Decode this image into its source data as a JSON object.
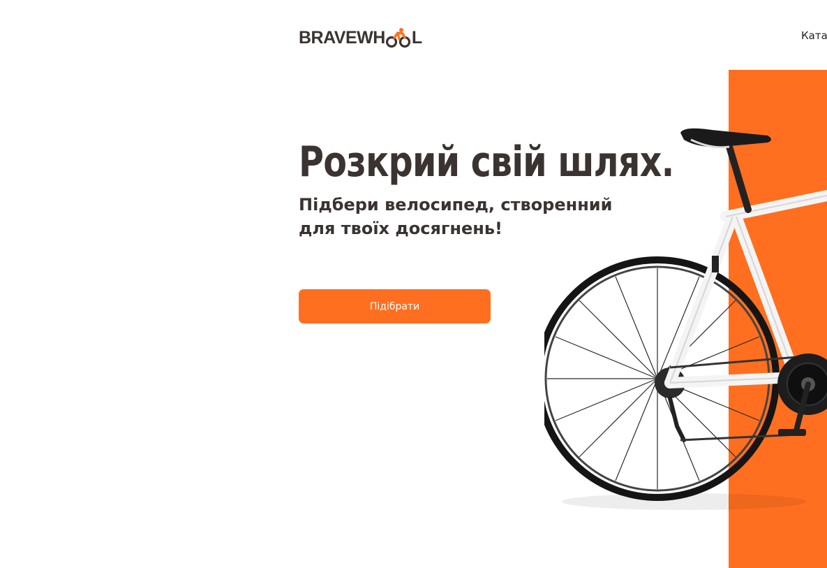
{
  "header": {
    "logo_text_left": "BRAVEWH",
    "logo_text_right": "L",
    "nav_link": "Катал"
  },
  "hero": {
    "title": "Розкрий свій шлях.",
    "subtitle": "Підбери велосипед, створенний для твоїх досягнень!",
    "cta_label": "Підібрати"
  },
  "colors": {
    "accent": "#ff6f1f",
    "text": "#3a3330",
    "background": "#ffffff"
  },
  "icons": {
    "logo_mark": "cyclist-icon",
    "hero_image": "road-bicycle-image"
  }
}
